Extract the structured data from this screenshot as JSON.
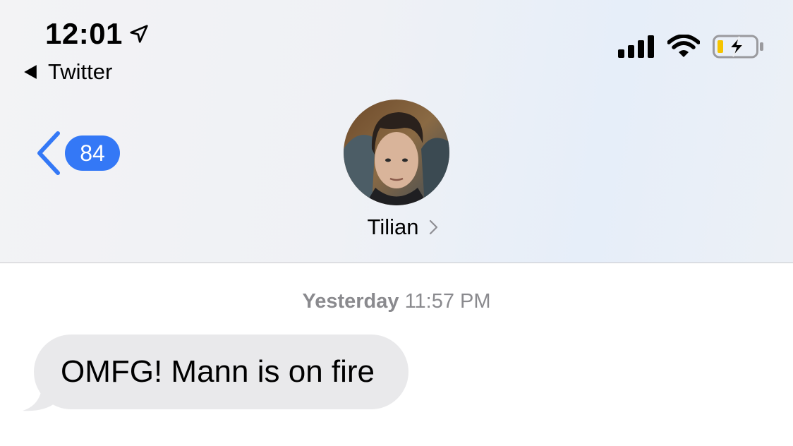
{
  "status_bar": {
    "time": "12:01",
    "back_app": "Twitter"
  },
  "nav": {
    "unread_count": "84",
    "contact_name": "Tilian"
  },
  "messages": [
    {
      "timestamp_day": "Yesterday",
      "timestamp_time": "11:57 PM",
      "text": "OMFG! Mann is on fire",
      "direction": "incoming"
    }
  ],
  "colors": {
    "accent": "#3478f6",
    "bubble_incoming": "#e9e9eb",
    "timestamp": "#8a8a8e",
    "battery_level": "#f5c400"
  },
  "icons": {
    "location": "location-arrow-icon",
    "signal": "cellular-signal-icon",
    "wifi": "wifi-icon",
    "battery": "battery-charging-icon"
  },
  "battery_level": 0.15
}
